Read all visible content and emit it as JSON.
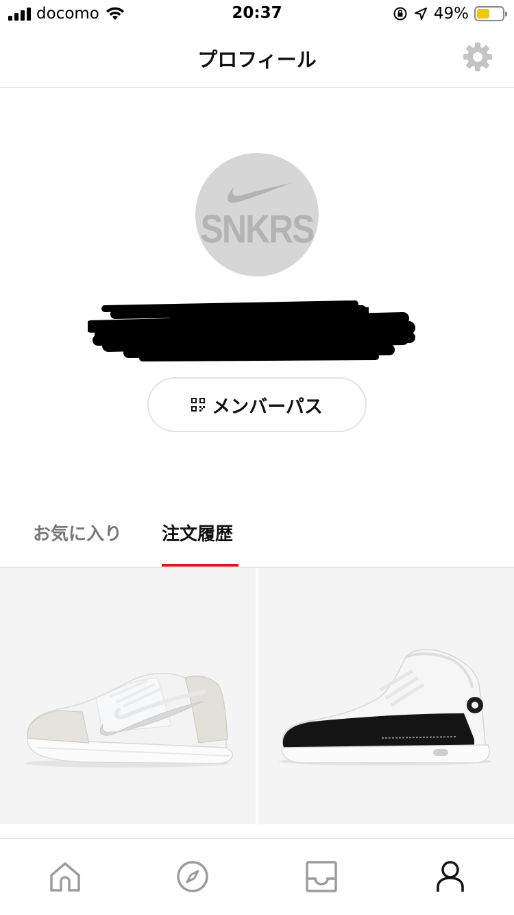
{
  "status_bar": {
    "carrier": "docomo",
    "time": "20:37",
    "battery": "49%",
    "battery_level": 0.49,
    "battery_color": "#f2c60b"
  },
  "header": {
    "title": "プロフィール",
    "settings_icon": "gear-icon"
  },
  "profile": {
    "avatar_text": "SNKRS",
    "avatar_logo": "swoosh-icon",
    "member_pass_label": "メンバーパス",
    "member_pass_icon": "qr-code-icon"
  },
  "tabs": [
    {
      "label": "お気に入り",
      "active": false
    },
    {
      "label": "注文履歴",
      "active": true
    }
  ],
  "accent_color": "#e3131b",
  "products": [
    {
      "image": "low-top-sneaker-white"
    },
    {
      "image": "high-top-sneaker-white-black"
    }
  ],
  "tabbar": {
    "items": [
      {
        "icon": "home-icon"
      },
      {
        "icon": "compass-icon"
      },
      {
        "icon": "inbox-icon"
      },
      {
        "icon": "profile-icon",
        "active": true
      }
    ]
  }
}
